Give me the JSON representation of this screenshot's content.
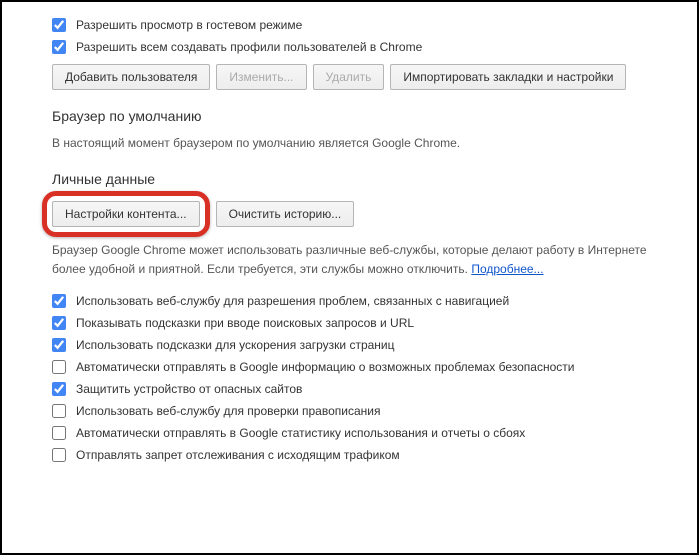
{
  "topChecks": {
    "guestMode": {
      "label": "Разрешить просмотр в гостевом режиме",
      "checked": true
    },
    "allowProfiles": {
      "label": "Разрешить всем создавать профили пользователей в Chrome",
      "checked": true
    }
  },
  "userButtons": {
    "addUser": "Добавить пользователя",
    "edit": "Изменить...",
    "delete": "Удалить",
    "importBookmarks": "Импортировать закладки и настройки"
  },
  "defaultBrowser": {
    "heading": "Браузер по умолчанию",
    "desc": "В настоящий момент браузером по умолчанию является Google Chrome."
  },
  "personalData": {
    "heading": "Личные данные",
    "contentSettings": "Настройки контента...",
    "clearHistory": "Очистить историю...",
    "desc": "Браузер Google Chrome может использовать различные веб-службы, которые делают работу в Интернете более удобной и приятной. Если требуется, эти службы можно отключить. ",
    "learnMore": "Подробнее..."
  },
  "privacyChecks": [
    {
      "label": "Использовать веб-службу для разрешения проблем, связанных с навигацией",
      "checked": true
    },
    {
      "label": "Показывать подсказки при вводе поисковых запросов и URL",
      "checked": true
    },
    {
      "label": "Использовать подсказки для ускорения загрузки страниц",
      "checked": true
    },
    {
      "label": "Автоматически отправлять в Google информацию о возможных проблемах безопасности",
      "checked": false
    },
    {
      "label": "Защитить устройство от опасных сайтов",
      "checked": true
    },
    {
      "label": "Использовать веб-службу для проверки правописания",
      "checked": false
    },
    {
      "label": "Автоматически отправлять в Google статистику использования и отчеты о сбоях",
      "checked": false
    },
    {
      "label": "Отправлять запрет отслеживания с исходящим трафиком",
      "checked": false
    }
  ]
}
